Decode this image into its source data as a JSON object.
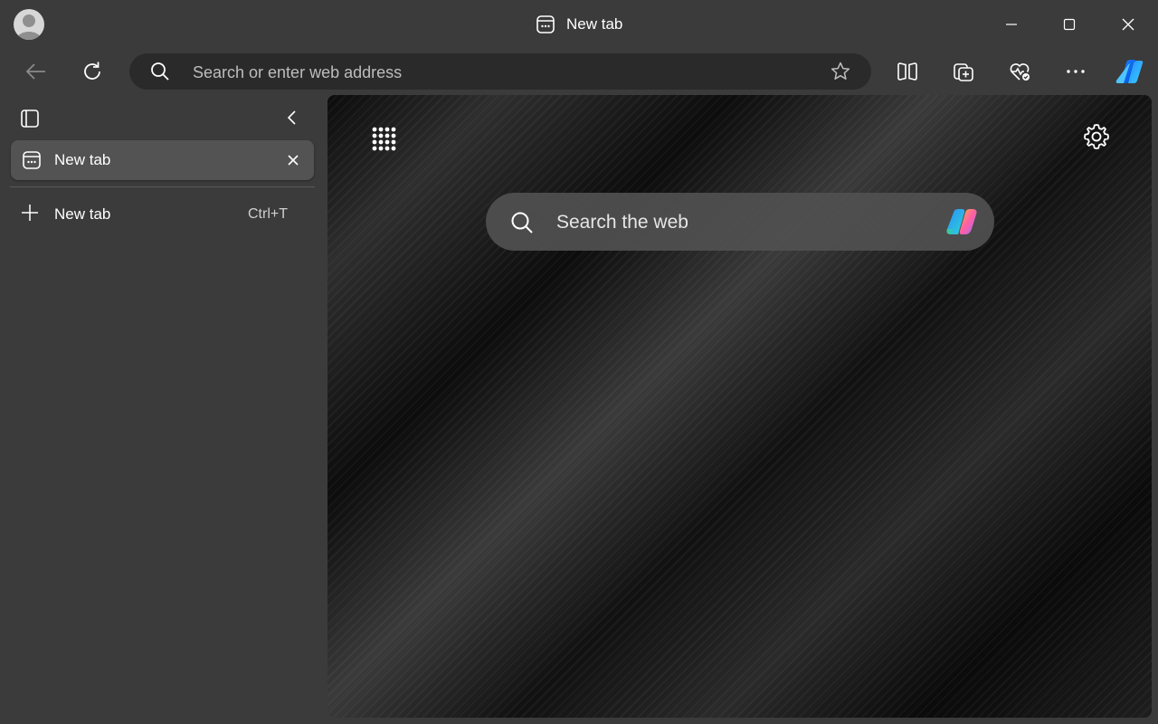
{
  "window": {
    "title": "New tab",
    "minimize_icon": "minimize-icon",
    "maximize_icon": "maximize-icon",
    "close_icon": "close-icon"
  },
  "toolbar": {
    "back_icon": "back-arrow-icon",
    "refresh_icon": "refresh-icon",
    "address_placeholder": "Search or enter web address",
    "favorite_icon": "star-icon",
    "split_screen_icon": "split-screen-icon",
    "collections_icon": "collections-icon",
    "browser_essentials_icon": "heart-pulse-icon",
    "more_icon": "ellipsis-icon",
    "copilot_icon": "copilot-icon"
  },
  "sidebar": {
    "tab_actions_icon": "tab-actions-icon",
    "collapse_icon": "chevron-left-icon",
    "tabs": [
      {
        "label": "New tab",
        "icon": "new-tab-page-icon",
        "close_icon": "close-icon"
      }
    ],
    "new_tab": {
      "label": "New tab",
      "shortcut": "Ctrl+T",
      "icon": "plus-icon"
    }
  },
  "ntp": {
    "apps_icon": "app-launcher-icon",
    "settings_icon": "gear-icon",
    "search_placeholder": "Search the web",
    "copilot_icon": "copilot-icon"
  }
}
